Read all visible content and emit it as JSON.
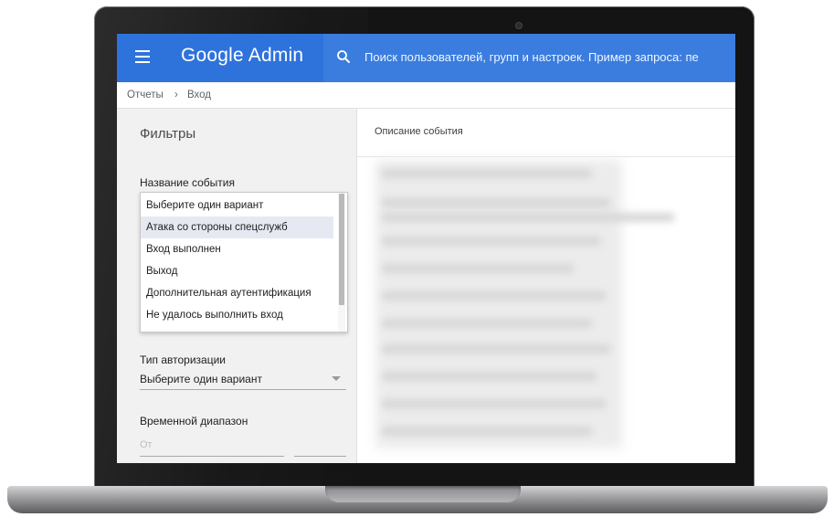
{
  "app": {
    "title": "Google Admin",
    "menu_icon": "hamburger-menu-icon",
    "brand_color": "#2e73dc"
  },
  "search": {
    "icon": "search-icon",
    "placeholder": "Поиск пользователей, групп и настроек. Пример запроса: пе"
  },
  "breadcrumb": {
    "items": [
      "Отчеты",
      "Вход"
    ],
    "separator": "›"
  },
  "sidebar": {
    "title": "Фильтры",
    "event_name": {
      "label": "Название события",
      "options": [
        "Выберите один вариант",
        "Атака со стороны спецслужб",
        "Вход выполнен",
        "Выход",
        "Дополнительная аутентификация",
        "Не удалось выполнить вход"
      ],
      "highlighted_option": "Атака со стороны спецслужб"
    },
    "auth_type": {
      "label": "Тип авторизации",
      "value": "Выберите один вариант"
    },
    "time_range": {
      "label": "Временной диапазон",
      "from_placeholder": "От"
    }
  },
  "main": {
    "column_header": "Описание события"
  }
}
